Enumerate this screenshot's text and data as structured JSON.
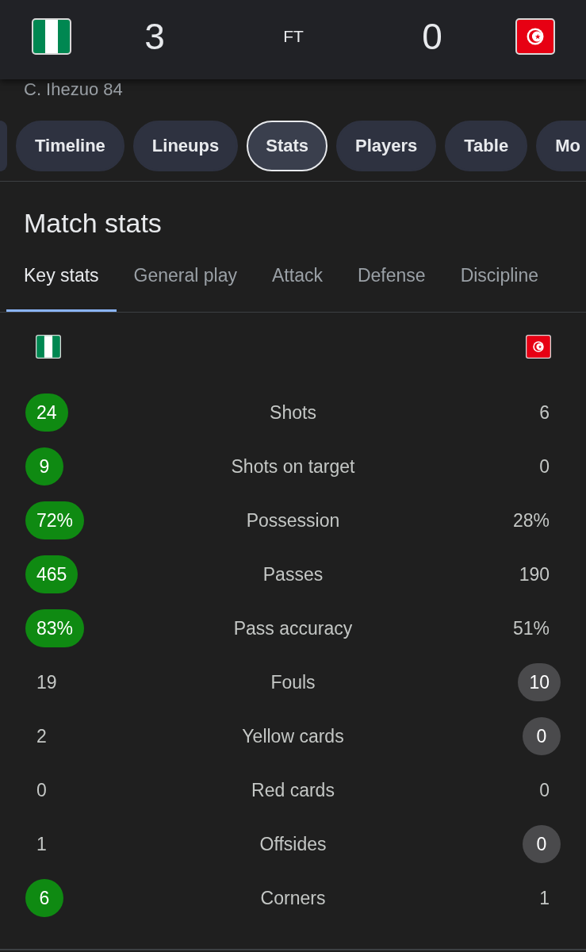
{
  "teams": [
    {
      "kind": "tricolor",
      "color": "#0f8a12"
    },
    {
      "kind": "crescent",
      "color": "#4a4a4c"
    }
  ],
  "score": {
    "home": "3",
    "status": "FT",
    "away": "0"
  },
  "scorer_line": "C. Ihezuo 84",
  "chips": [
    {
      "selected": false
    },
    {
      "label": "Timeline",
      "selected": false
    },
    {
      "label": "Lineups",
      "selected": false
    },
    {
      "label": "Stats",
      "selected": true
    },
    {
      "label": "Players",
      "selected": false
    },
    {
      "label": "Table",
      "selected": false
    },
    {
      "label": "Mo",
      "selected": false
    }
  ],
  "section_title": "Match stats",
  "tabs": [
    {
      "label": "Key stats",
      "selected": true
    },
    {
      "label": "General play",
      "selected": false
    },
    {
      "label": "Attack",
      "selected": false
    },
    {
      "label": "Defense",
      "selected": false
    },
    {
      "label": "Discipline",
      "selected": false
    }
  ],
  "stats": [
    {
      "label": "Shots",
      "home": {
        "value": "24",
        "highlighted": true
      },
      "away": {
        "value": "6",
        "highlighted": false
      }
    },
    {
      "label": "Shots on target",
      "home": {
        "value": "9",
        "highlighted": true
      },
      "away": {
        "value": "0",
        "highlighted": false
      }
    },
    {
      "label": "Possession",
      "home": {
        "value": "72%",
        "highlighted": true
      },
      "away": {
        "value": "28%",
        "highlighted": false
      }
    },
    {
      "label": "Passes",
      "home": {
        "value": "465",
        "highlighted": true
      },
      "away": {
        "value": "190",
        "highlighted": false
      }
    },
    {
      "label": "Pass accuracy",
      "home": {
        "value": "83%",
        "highlighted": true
      },
      "away": {
        "value": "51%",
        "highlighted": false
      }
    },
    {
      "label": "Fouls",
      "home": {
        "value": "19",
        "highlighted": false
      },
      "away": {
        "value": "10",
        "highlighted": true
      }
    },
    {
      "label": "Yellow cards",
      "home": {
        "value": "2",
        "highlighted": false
      },
      "away": {
        "value": "0",
        "highlighted": true
      }
    },
    {
      "label": "Red cards",
      "home": {
        "value": "0",
        "highlighted": false
      },
      "away": {
        "value": "0",
        "highlighted": false
      }
    },
    {
      "label": "Offsides",
      "home": {
        "value": "1",
        "highlighted": false
      },
      "away": {
        "value": "0",
        "highlighted": true
      }
    },
    {
      "label": "Corners",
      "home": {
        "value": "6",
        "highlighted": true
      },
      "away": {
        "value": "1",
        "highlighted": false
      }
    }
  ]
}
